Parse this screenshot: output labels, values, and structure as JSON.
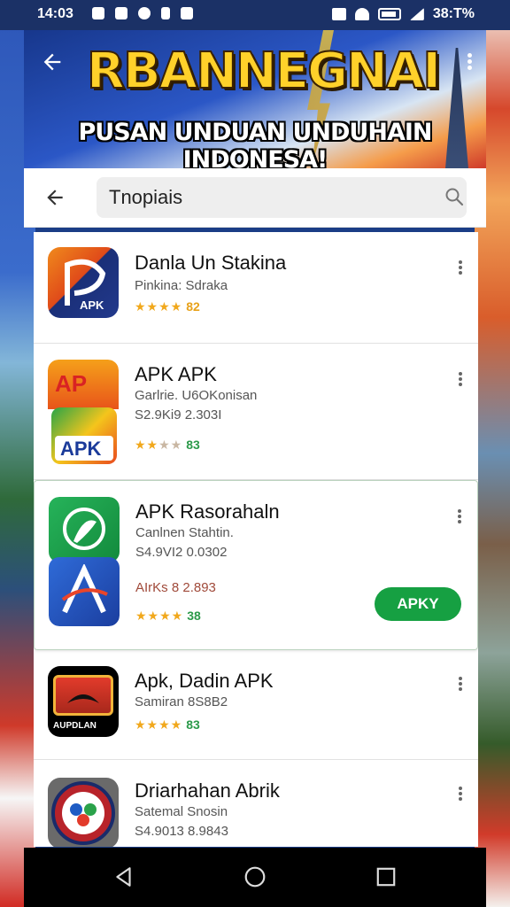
{
  "status_bar": {
    "time": "14:03",
    "battery_text": "38:T%"
  },
  "banner": {
    "title": "RBANNEGNAI",
    "subtitle": "PUSAN UNDUAN UNDUHAIN INDONESA!"
  },
  "search": {
    "value": "Tnopiais"
  },
  "apps": [
    {
      "name": "Danla Un Stakina",
      "line1": "Pinkina: Sdraka",
      "line2": "",
      "line3": "",
      "stars": "★★★★",
      "stars_dim": "",
      "rating": "82",
      "icon_label": "APK"
    },
    {
      "name": "APK APK",
      "line1": "Garlrie. U6OKonisan",
      "line2": "S2.9Ki9 2.303I",
      "line3": "",
      "stars": "★★",
      "stars_dim": "★★",
      "rating": "83",
      "icon_label_top": "AP",
      "icon_label_bottom": "APK"
    },
    {
      "name": "APK Rasorahaln",
      "line1": "Canlnen Stahtin.",
      "line2": "S4.9VI2 0.0302",
      "line3": "AIrKs 8 2.893",
      "stars": "★★★★",
      "stars_dim": "",
      "rating": "38",
      "button": "APKY"
    },
    {
      "name": "Apk, Dadin APK",
      "line1": "Samiran 8S8B2",
      "line2": "",
      "line3": "",
      "stars": "★★★★",
      "stars_dim": "",
      "rating": "83",
      "icon_label": "AUPDLAN"
    },
    {
      "name": "Driarhahan Abrik",
      "line1": "Satemal Snosin",
      "line2": "S4.9013 8.9843",
      "line3": "",
      "stars": "",
      "stars_dim": "",
      "rating": ""
    }
  ],
  "colors": {
    "accent_green": "#16a042",
    "banner_title": "#ffd12a",
    "star": "#f1a81c"
  }
}
